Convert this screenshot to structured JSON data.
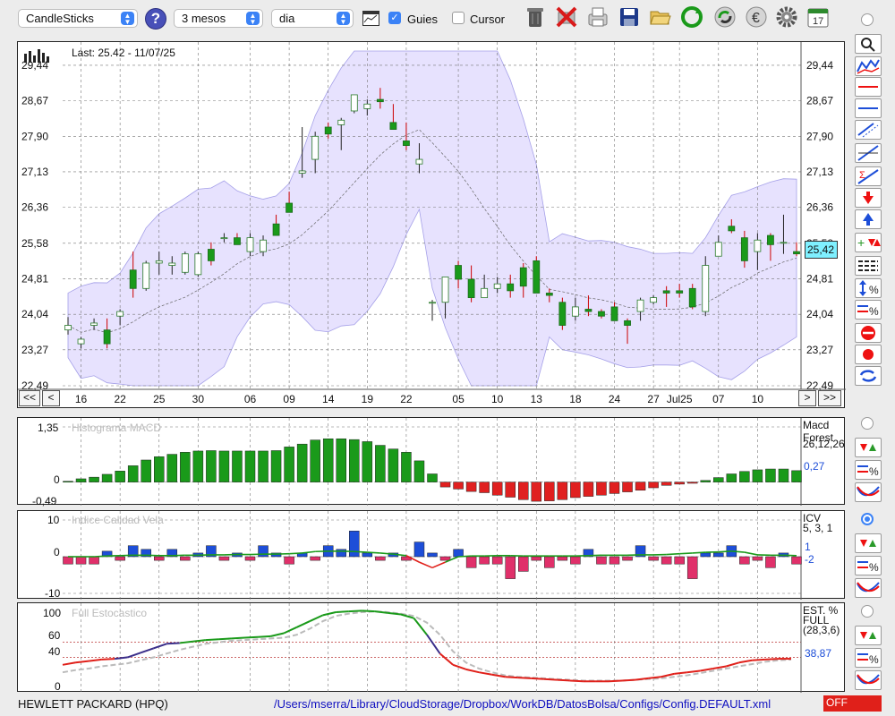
{
  "toolbar": {
    "chart_type": "CandleSticks",
    "period": "3 mesos",
    "interval": "dia",
    "guies_label": "Guies",
    "guies_checked": true,
    "cursor_label": "Cursor",
    "cursor_checked": false,
    "calendar_day": "17",
    "icons": [
      "help-icon",
      "chart-settings-icon",
      "trash-icon",
      "delete-icon",
      "print-icon",
      "save-icon",
      "open-folder-icon",
      "refresh-icon",
      "cycle-icon",
      "currency-icon",
      "gear-icon",
      "calendar-icon"
    ]
  },
  "main_chart": {
    "last_label": "Last: 25.42 - 11/07/25",
    "current_price": "25,42",
    "y_ticks": [
      "29,44",
      "28,67",
      "27,90",
      "27,13",
      "26,36",
      "25,58",
      "24,81",
      "24,04",
      "23,27",
      "22,49"
    ],
    "x_ticks": [
      "16",
      "22",
      "25",
      "30",
      "06",
      "09",
      "14",
      "19",
      "22",
      "05",
      "10",
      "13",
      "18",
      "24",
      "27",
      "Jul25",
      "07",
      "10"
    ],
    "nav": {
      "first": "<<",
      "prev": "<",
      "next": ">",
      "last": ">>"
    }
  },
  "chart_data": [
    {
      "type": "candlestick",
      "title": "",
      "ylim": [
        22.49,
        29.75
      ],
      "grid": true,
      "bollinger": true,
      "candles": [
        [
          23.7,
          23.98,
          23.6,
          23.8
        ],
        [
          23.4,
          23.55,
          23.3,
          23.5
        ],
        [
          23.8,
          23.95,
          23.7,
          23.85
        ],
        [
          23.7,
          23.95,
          23.3,
          23.4
        ],
        [
          24.0,
          24.15,
          23.8,
          24.1
        ],
        [
          25.0,
          25.4,
          24.4,
          24.6
        ],
        [
          24.6,
          25.2,
          24.55,
          25.15
        ],
        [
          25.15,
          25.4,
          24.9,
          25.2
        ],
        [
          25.1,
          25.3,
          24.9,
          25.15
        ],
        [
          24.95,
          25.4,
          24.9,
          25.35
        ],
        [
          24.9,
          25.4,
          24.85,
          25.35
        ],
        [
          25.45,
          25.6,
          25.1,
          25.2
        ],
        [
          25.7,
          25.8,
          25.6,
          25.7
        ],
        [
          25.7,
          25.8,
          25.6,
          25.55
        ],
        [
          25.4,
          25.8,
          25.3,
          25.7
        ],
        [
          25.4,
          25.75,
          25.3,
          25.65
        ],
        [
          26.0,
          26.2,
          25.9,
          25.75
        ],
        [
          26.45,
          26.7,
          26.3,
          26.25
        ],
        [
          27.1,
          28.1,
          27.0,
          27.15
        ],
        [
          27.4,
          28.0,
          27.1,
          27.9
        ],
        [
          28.1,
          28.2,
          27.85,
          27.95
        ],
        [
          28.15,
          28.3,
          27.6,
          28.25
        ],
        [
          28.45,
          28.7,
          28.4,
          28.8
        ],
        [
          28.5,
          28.7,
          28.35,
          28.6
        ],
        [
          28.7,
          28.95,
          28.5,
          28.65
        ],
        [
          28.2,
          28.6,
          28.05,
          28.05
        ],
        [
          27.8,
          28.2,
          27.6,
          27.7
        ],
        [
          27.3,
          27.75,
          27.1,
          27.4
        ],
        [
          24.3,
          24.35,
          23.9,
          24.3
        ],
        [
          24.3,
          24.45,
          23.95,
          24.85
        ],
        [
          25.1,
          25.2,
          24.6,
          24.8
        ],
        [
          24.8,
          25.1,
          24.3,
          24.4
        ],
        [
          24.4,
          24.9,
          24.4,
          24.6
        ],
        [
          24.6,
          24.85,
          24.5,
          24.7
        ],
        [
          24.7,
          24.9,
          24.4,
          24.55
        ],
        [
          25.05,
          25.15,
          24.4,
          24.65
        ],
        [
          25.2,
          25.3,
          24.55,
          24.5
        ],
        [
          24.5,
          24.6,
          24.3,
          24.45
        ],
        [
          24.3,
          24.4,
          23.7,
          23.8
        ],
        [
          24.0,
          24.4,
          23.9,
          24.2
        ],
        [
          24.15,
          24.45,
          24.0,
          24.1
        ],
        [
          24.1,
          24.15,
          23.95,
          24.0
        ],
        [
          24.2,
          24.3,
          23.9,
          23.9
        ],
        [
          23.9,
          23.95,
          23.4,
          23.8
        ],
        [
          24.1,
          24.4,
          23.9,
          24.35
        ],
        [
          24.3,
          24.45,
          24.25,
          24.4
        ],
        [
          24.55,
          24.65,
          24.2,
          24.5
        ],
        [
          24.55,
          24.7,
          24.4,
          24.5
        ],
        [
          24.6,
          24.7,
          24.15,
          24.2
        ],
        [
          24.1,
          25.3,
          24.0,
          25.1
        ],
        [
          25.3,
          25.75,
          25.3,
          25.6
        ],
        [
          25.95,
          26.1,
          25.8,
          25.85
        ],
        [
          25.7,
          25.85,
          25.05,
          25.2
        ],
        [
          25.4,
          25.8,
          25.0,
          25.65
        ],
        [
          25.75,
          25.8,
          25.2,
          25.55
        ],
        [
          25.6,
          26.2,
          25.35,
          25.6
        ],
        [
          25.4,
          25.6,
          25.3,
          25.35
        ]
      ]
    },
    {
      "type": "bar",
      "title": "Histograma MACD",
      "ylim": [
        -0.49,
        1.35
      ],
      "values": [
        0.02,
        0.08,
        0.12,
        0.19,
        0.27,
        0.4,
        0.54,
        0.62,
        0.68,
        0.73,
        0.76,
        0.77,
        0.76,
        0.76,
        0.76,
        0.76,
        0.77,
        0.86,
        0.93,
        1.03,
        1.06,
        1.06,
        1.04,
        0.99,
        0.9,
        0.81,
        0.73,
        0.52,
        0.2,
        -0.12,
        -0.17,
        -0.23,
        -0.26,
        -0.32,
        -0.37,
        -0.43,
        -0.47,
        -0.46,
        -0.43,
        -0.38,
        -0.35,
        -0.32,
        -0.28,
        -0.24,
        -0.2,
        -0.14,
        -0.08,
        -0.05,
        -0.03,
        0.04,
        0.11,
        0.2,
        0.26,
        0.3,
        0.32,
        0.32,
        0.28
      ]
    },
    {
      "type": "bar",
      "title": "Indice Calidad Vela",
      "ylim": [
        -10,
        10
      ],
      "values": [
        -2,
        -2,
        -2,
        1.5,
        -1,
        3,
        2,
        -1,
        2,
        -1,
        1,
        3,
        -1,
        1,
        -1,
        3,
        1,
        -2,
        1,
        -1,
        3,
        2,
        7,
        1,
        -1,
        1,
        -1,
        4,
        1,
        -1,
        2,
        -3,
        -2,
        -2,
        -6,
        -4,
        -1,
        -3,
        -1,
        -2,
        2,
        -2,
        -2,
        -1,
        3,
        -1,
        -2,
        -2,
        -6,
        1,
        1,
        3,
        -2,
        -1,
        -3,
        1,
        -2
      ],
      "line": [
        0,
        0,
        0,
        0.2,
        0.3,
        0.4,
        0.4,
        0.3,
        0.3,
        0.4,
        0.4,
        0.5,
        0.5,
        0.6,
        0.6,
        0.7,
        0.7,
        0.8,
        1.0,
        1.4,
        1.5,
        1.5,
        1.4,
        1.2,
        1.0,
        0.7,
        0.3,
        -1.5,
        -3.0,
        -1.5,
        0,
        0.2,
        0.2,
        0.3,
        0.3,
        0.2,
        0.2,
        0.2,
        0.2,
        0.2,
        0.3,
        0.4,
        0.4,
        0.4,
        0.5,
        0.5,
        0.6,
        0.8,
        1.0,
        1.2,
        1.3,
        1.5,
        1.2,
        0.5,
        0.4,
        0.4,
        0.3
      ]
    },
    {
      "type": "line",
      "title": "Full Estocastico",
      "ylim": [
        0,
        100
      ],
      "x": [
        0,
        1,
        2,
        3,
        4,
        5,
        6,
        7,
        8,
        9,
        10,
        11,
        12,
        13,
        14,
        15,
        16,
        17,
        18,
        19,
        20,
        21,
        22,
        23,
        24,
        25,
        26,
        27,
        28,
        29,
        30,
        31,
        32,
        33,
        34,
        35,
        36,
        37,
        38,
        39,
        40,
        41,
        42,
        43,
        44,
        45,
        46,
        47,
        48,
        49,
        50,
        51,
        52,
        53,
        54,
        55,
        56
      ],
      "series": [
        {
          "name": "K",
          "values": [
            30,
            33,
            35,
            37,
            38,
            40,
            46,
            52,
            58,
            59,
            61,
            63,
            64,
            65,
            66,
            67,
            68,
            72,
            80,
            88,
            96,
            100,
            101,
            102,
            101,
            99,
            97,
            92,
            70,
            45,
            30,
            24,
            20,
            17,
            14,
            13,
            12,
            11,
            10,
            9,
            8,
            8,
            8,
            9,
            10,
            12,
            14,
            18,
            20,
            22,
            25,
            28,
            33,
            36,
            37,
            38,
            38
          ]
        },
        {
          "name": "D",
          "values": [
            20,
            23,
            25,
            28,
            30,
            32,
            36,
            40,
            45,
            50,
            54,
            58,
            60,
            62,
            63,
            64,
            65,
            66,
            70,
            78,
            88,
            95,
            98,
            100,
            101,
            100,
            98,
            95,
            86,
            70,
            48,
            33,
            25,
            20,
            16,
            14,
            13,
            12,
            11,
            10,
            9,
            9,
            9,
            9,
            10,
            11,
            12,
            14,
            16,
            19,
            22,
            25,
            28,
            31,
            34,
            36,
            37
          ]
        }
      ],
      "current_value": "38,87"
    }
  ],
  "macd": {
    "title": "Histograma MACD",
    "name": "Macd Forest",
    "params": "26,12,26",
    "current": "0,27",
    "y_ticks": [
      "1,35",
      "0",
      "-0,49"
    ]
  },
  "icv": {
    "title": "Indice Calidad Vela",
    "name": "ICV",
    "params": "5, 3, 1",
    "current1": "1",
    "current2": "-2",
    "y_ticks": [
      "10",
      "0",
      "-10"
    ]
  },
  "stoch": {
    "title": "Full Estocastico",
    "name": "EST. %",
    "sub": "FULL",
    "params": "(28,3,6)",
    "current": "38,87",
    "y_ticks": [
      "100",
      "60",
      "40",
      "0"
    ]
  },
  "status": {
    "ticker": "HEWLETT PACKARD (HPQ)",
    "path": "/Users/mserra/Library/CloudStorage/Dropbox/WorkDB/DatosBolsa/Configs/Config.DEFAULT.xml",
    "off_label": "OFF"
  },
  "side_tools": [
    "zoom-icon",
    "chart-overlay-icon",
    "hline-red-icon",
    "hline-blue-icon",
    "channel-icon",
    "trendline-icon",
    "fibonacci-icon",
    "arrow-down-icon",
    "arrow-up-icon",
    "buy-sell-icon",
    "grid-lines-icon",
    "zoom-percent-icon",
    "scale-percent-icon",
    "stop-icon",
    "record-icon",
    "sync-icon"
  ],
  "colors": {
    "bull": "#16a34a",
    "bear": "#ef4444",
    "band": "#ddd6fe",
    "pos_bar": "#1a9a1a",
    "neg_bar": "#e02020",
    "icv_pos": "#1d4ed8",
    "icv_neg": "#e0306a",
    "k_line": "#1a9a1a",
    "d_line": "#bbbbbb",
    "accent": "#3b82f6"
  }
}
